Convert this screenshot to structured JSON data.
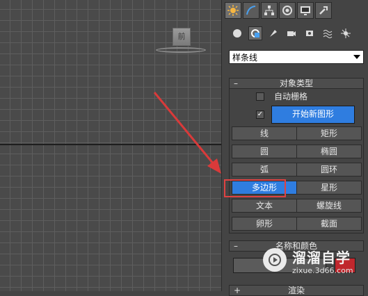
{
  "viewport": {
    "viewcube_label": "前"
  },
  "panel": {
    "tabs": [
      "create-icon",
      "modify-icon",
      "hierarchy-icon",
      "motion-icon",
      "display-icon",
      "utilities-icon"
    ],
    "subcategories": [
      "geometry-icon",
      "shapes-icon",
      "lights-icon",
      "cameras-icon",
      "helpers-icon",
      "spacewarps-icon",
      "systems-icon"
    ],
    "dropdown_value": "样条线",
    "object_type": {
      "header": "对象类型",
      "collapse": "–",
      "autogrid_label": "自动栅格",
      "start_new_shape_check": "✓",
      "start_new_shape_label": "开始新图形",
      "buttons": [
        "线",
        "矩形",
        "圆",
        "椭圆",
        "弧",
        "圆环",
        "多边形",
        "星形",
        "文本",
        "螺旋线",
        "卵形",
        "截面"
      ],
      "selected": "多边形"
    },
    "name_color": {
      "header": "名称和颜色",
      "collapse": "–"
    },
    "next_rollout": {
      "header": "渲染",
      "collapse": "+"
    }
  },
  "colors": {
    "accent": "#2f7de0",
    "highlight": "#e04242",
    "arrow": "#d93a3a",
    "swatch": "#c0272d"
  },
  "watermark": {
    "name": "溜溜自学",
    "site": "zixue.3d66.com"
  }
}
